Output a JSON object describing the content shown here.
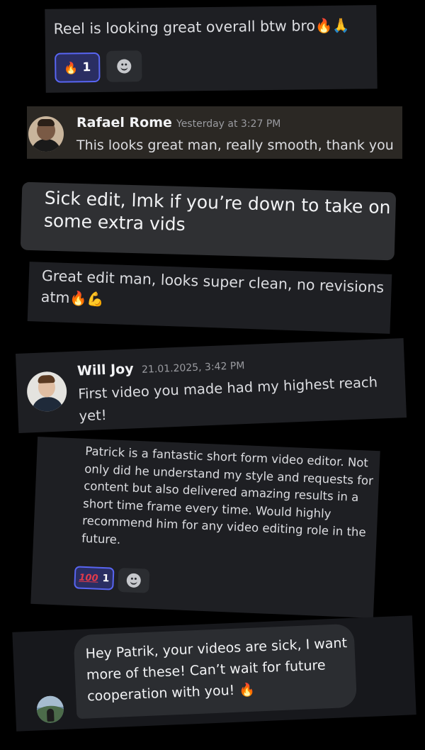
{
  "cards": [
    {
      "text": "Reel is looking great overall btw bro",
      "emoji": "🔥🙏",
      "reaction": {
        "emoji": "🔥",
        "count": "1"
      }
    },
    {
      "author": "Rafael Rome",
      "timestamp": "Yesterday at 3:27 PM",
      "message": "This looks great man, really smooth, thank you"
    },
    {
      "text": "Sick edit, lmk if you’re down to take on some extra vids"
    },
    {
      "text": "Great edit man, looks super clean, no revisions atm",
      "emoji": "🔥💪"
    },
    {
      "author": "Will Joy",
      "timestamp": "21.01.2025, 3:42 PM",
      "message": "First video you made  had my highest reach yet!"
    },
    {
      "text": "Patrick is a fantastic short form video editor. Not only did he understand my style and requests for content but also delivered amazing results in a short time frame every time. Would highly recommend him for any video editing role in the future.",
      "reaction": {
        "emoji": "100",
        "count": "1"
      }
    },
    {
      "text": "Hey Patrik, your videos are sick, I want more of these! Can’t wait for future cooperation with you!",
      "emoji": "🔥"
    }
  ],
  "colors": {
    "background": "#000000",
    "card": "#1e1f23",
    "reaction_active_border": "#5865f2",
    "reaction_active_bg": "#2a2e62",
    "timestamp": "#9a9ba0"
  },
  "icons": {
    "add_reaction": "smiley-face-icon",
    "reaction_fire": "fire-emoji",
    "reaction_100": "hundred-points-emoji"
  }
}
